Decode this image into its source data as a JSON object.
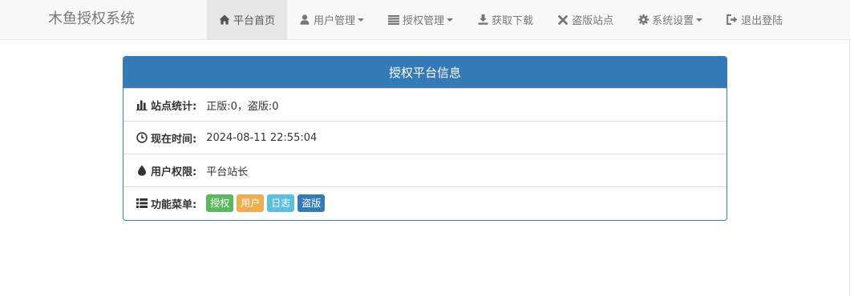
{
  "colors": {
    "primary": "#337ab7",
    "success": "#5cb85c",
    "warning": "#f0ad4e",
    "info": "#5bc0de",
    "navbar_bg": "#f8f8f8",
    "active_bg": "#e7e7e7"
  },
  "navbar": {
    "brand": "木鱼授权系统",
    "items": [
      {
        "label": "平台首页",
        "icon": "home-icon",
        "active": true,
        "dropdown": false
      },
      {
        "label": "用户管理",
        "icon": "user-icon",
        "active": false,
        "dropdown": true
      },
      {
        "label": "授权管理",
        "icon": "list-icon",
        "active": false,
        "dropdown": true
      },
      {
        "label": "获取下载",
        "icon": "download-icon",
        "active": false,
        "dropdown": false
      },
      {
        "label": "盗版站点",
        "icon": "close-icon",
        "active": false,
        "dropdown": false
      },
      {
        "label": "系统设置",
        "icon": "gear-icon",
        "active": false,
        "dropdown": true
      },
      {
        "label": "退出登陆",
        "icon": "logout-icon",
        "active": false,
        "dropdown": false
      }
    ]
  },
  "panel": {
    "title": "授权平台信息",
    "rows": [
      {
        "label": "站点统计:",
        "value": "正版:0，盗版:0",
        "icon": "stats-icon"
      },
      {
        "label": "现在时间:",
        "value": "2024-08-11 22:55:04",
        "icon": "clock-icon"
      },
      {
        "label": "用户权限:",
        "value": "平台站长",
        "icon": "drop-icon"
      },
      {
        "label": "功能菜单:",
        "icon": "menu-list-icon"
      }
    ],
    "menu_badges": [
      {
        "label": "授权",
        "color": "#5cb85c"
      },
      {
        "label": "用户",
        "color": "#f0ad4e"
      },
      {
        "label": "日志",
        "color": "#5bc0de"
      },
      {
        "label": "盗版",
        "color": "#337ab7"
      }
    ]
  }
}
